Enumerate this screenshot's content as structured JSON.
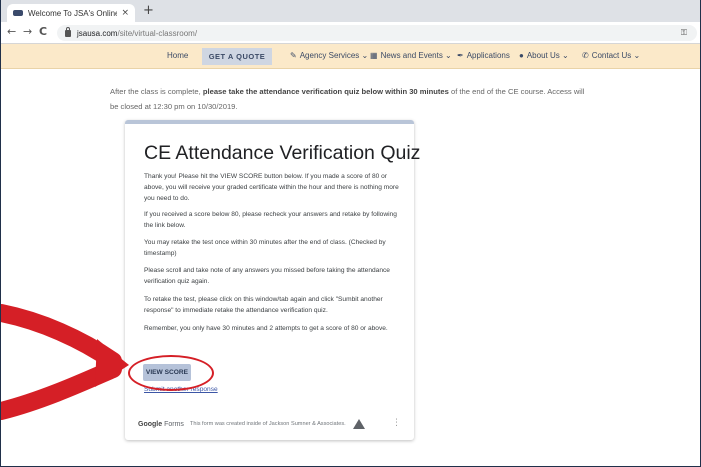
{
  "browser": {
    "tab_title": "Welcome To JSA's Online CE – Ja",
    "tab_close": "×",
    "new_tab": "+",
    "back": "←",
    "forward": "→",
    "reload": "C",
    "url_host": "jsausa.com",
    "url_path": "/site/virtual-classroom/"
  },
  "site_nav": {
    "home": "Home",
    "get_quote": "GET A QUOTE",
    "agency_services": "Agency Services ⌄",
    "news_events": "News and Events ⌄",
    "applications": "Applications",
    "about_us": "About Us ⌄",
    "contact_us": "Contact Us ⌄"
  },
  "intro": {
    "before": "After the class is complete, ",
    "bold": "please take the attendance verification quiz below within 30 minutes",
    "after": " of the end of the CE course. Access will be closed at 12:30 pm on 10/30/2019."
  },
  "form": {
    "title": "CE Attendance Verification Quiz",
    "paragraphs": [
      "Thank you! Please hit the VIEW SCORE button below. If you made a score of 80 or above, you will receive your graded certificate within the hour and there is nothing more you need to do.",
      "If you received a score below 80, please recheck your answers and retake by following the link below.",
      "You may retake the test once within 30 minutes after the end of class. (Checked by timestamp)",
      "Please scroll and take note of any answers you missed before taking the attendance verification quiz again.",
      "To retake the test, please click on this window/tab again and click \"Sumbit another response\" to immediate retake the attendance verification quiz.",
      "Remember, you only have 30 minutes and 2 attempts to get a score of 80 or above."
    ],
    "view_score": "VIEW SCORE",
    "submit_another": "Submit another response",
    "google": "Google",
    "forms": "Forms",
    "footer_note": "This form was created inside of Jackson Sumner & Associates.",
    "more": "⋮"
  },
  "colors": {
    "nav_bg": "#fbe9c9",
    "button_bg": "#b5c2d9",
    "annotation": "#d51f26"
  }
}
